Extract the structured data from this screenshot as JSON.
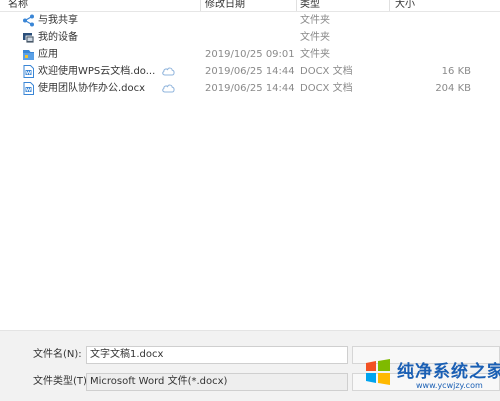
{
  "columns": {
    "name": "名称",
    "modified": "修改日期",
    "type": "类型",
    "size": "大小"
  },
  "files": [
    {
      "name": "与我共享",
      "modified": "",
      "type": "文件夹",
      "size": "",
      "icon": "share-icon",
      "cloud": false
    },
    {
      "name": "我的设备",
      "modified": "",
      "type": "文件夹",
      "size": "",
      "icon": "device-icon",
      "cloud": false
    },
    {
      "name": "应用",
      "modified": "2019/10/25 09:01",
      "type": "文件夹",
      "size": "",
      "icon": "app-folder-icon",
      "cloud": false
    },
    {
      "name": "欢迎使用WPS云文档.do...",
      "modified": "2019/06/25 14:44",
      "type": "DOCX 文档",
      "size": "16 KB",
      "icon": "docx-icon",
      "cloud": true
    },
    {
      "name": "使用团队协作办公.docx",
      "modified": "2019/06/25 14:44",
      "type": "DOCX 文档",
      "size": "204 KB",
      "icon": "docx-icon",
      "cloud": true
    }
  ],
  "filename": {
    "label": "文件名(N):",
    "value": "文字文稿1.docx"
  },
  "filetype": {
    "label": "文件类型(T):",
    "value": "Microsoft Word 文件(*.docx)"
  },
  "watermark": {
    "brand": "纯净系统之家",
    "url": "www.ycwjzy.com"
  },
  "colors": {
    "icon_blue": "#3a86d6",
    "cloud": "#8fb4dc",
    "watermark_blue": "#1a5fb4"
  }
}
